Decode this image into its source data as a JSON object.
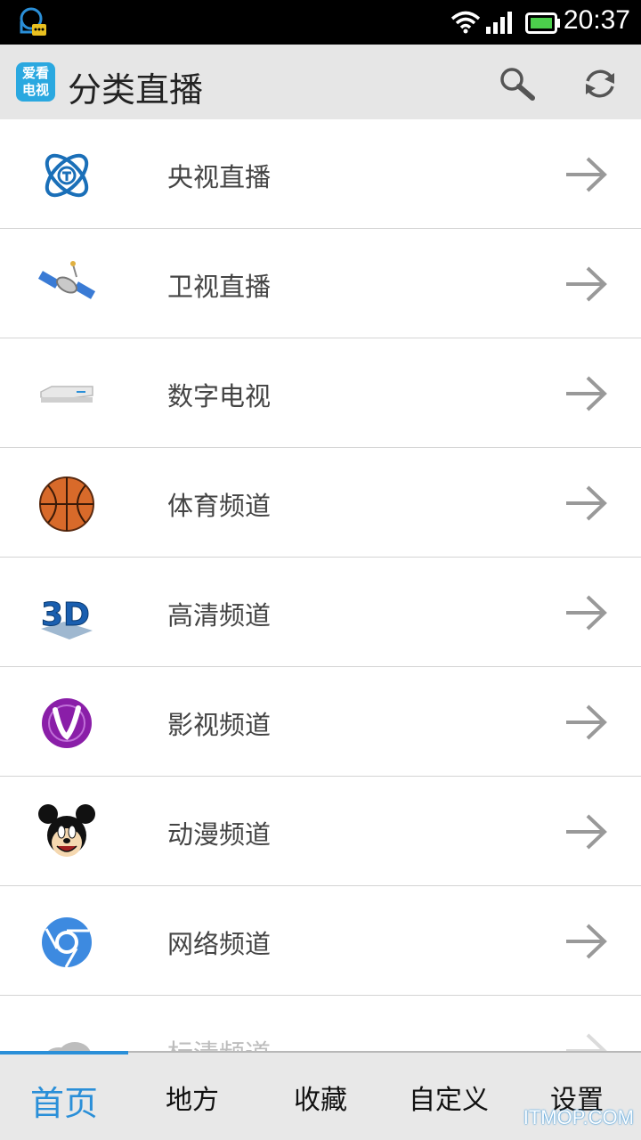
{
  "status_bar": {
    "time": "20:37"
  },
  "app_bar": {
    "logo_text_top": "爱看",
    "logo_text_bottom": "电视",
    "title": "分类直播",
    "search_icon": "search-icon",
    "refresh_icon": "refresh-icon"
  },
  "list": {
    "items": [
      {
        "label": "央视直播",
        "icon": "cctv-logo-icon"
      },
      {
        "label": "卫视直播",
        "icon": "satellite-icon"
      },
      {
        "label": "数字电视",
        "icon": "set-top-box-icon"
      },
      {
        "label": "体育频道",
        "icon": "basketball-icon"
      },
      {
        "label": "高清频道",
        "icon": "3d-icon"
      },
      {
        "label": "影视频道",
        "icon": "film-v-icon"
      },
      {
        "label": "动漫频道",
        "icon": "mickey-icon"
      },
      {
        "label": "网络频道",
        "icon": "chrome-icon"
      },
      {
        "label": "标清频道",
        "icon": "cloud-icon"
      }
    ]
  },
  "tabs": [
    {
      "label": "首页",
      "active": true
    },
    {
      "label": "地方"
    },
    {
      "label": "收藏"
    },
    {
      "label": "自定义"
    },
    {
      "label": "设置"
    }
  ],
  "watermark": "ITMOP.COM",
  "colors": {
    "accent": "#2a8fd8",
    "app_bar_bg": "#e6e6e6",
    "tab_bar_bg": "#e8e8e8"
  }
}
